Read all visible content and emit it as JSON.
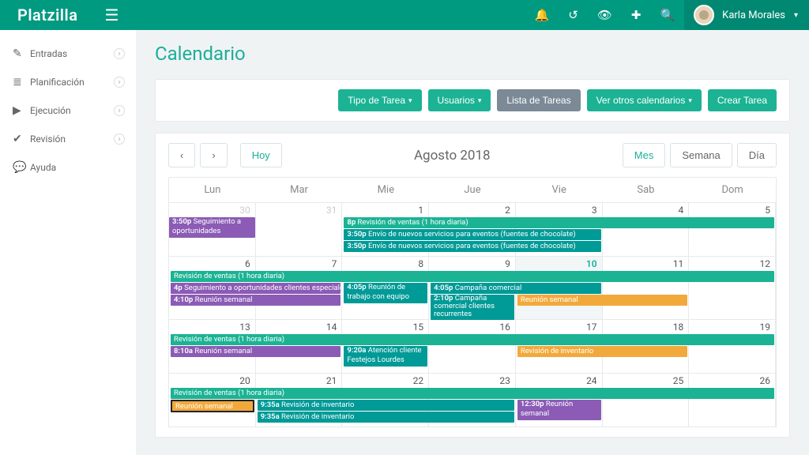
{
  "brand": "Platzilla",
  "user": {
    "name": "Karla Morales"
  },
  "sidebar": {
    "items": [
      {
        "icon": "✎",
        "label": "Entradas",
        "chev": true
      },
      {
        "icon": "≣",
        "label": "Planificación",
        "chev": true
      },
      {
        "icon": "▶",
        "label": "Ejecución",
        "chev": true
      },
      {
        "icon": "✔",
        "label": "Revisión",
        "chev": true
      },
      {
        "icon": "💬",
        "label": "Ayuda",
        "chev": false
      }
    ]
  },
  "page": {
    "title": "Calendario"
  },
  "toolbar": {
    "tipo": "Tipo de Tarea",
    "usuarios": "Usuarios",
    "lista": "Lista de Tareas",
    "otros": "Ver otros calendarios",
    "crear": "Crear Tarea"
  },
  "calnav": {
    "prev": "‹",
    "next": "›",
    "today": "Hoy",
    "title": "Agosto 2018",
    "mes": "Mes",
    "semana": "Semana",
    "dia": "Día"
  },
  "dayheaders": [
    "Lun",
    "Mar",
    "Mie",
    "Jue",
    "Vie",
    "Sab",
    "Dom"
  ],
  "weeks": [
    {
      "nums": [
        {
          "n": "30",
          "other": true
        },
        {
          "n": "31",
          "other": true
        },
        {
          "n": "1"
        },
        {
          "n": "2"
        },
        {
          "n": "3"
        },
        {
          "n": "4"
        },
        {
          "n": "5"
        }
      ]
    },
    {
      "nums": [
        {
          "n": "6"
        },
        {
          "n": "7"
        },
        {
          "n": "8"
        },
        {
          "n": "9"
        },
        {
          "n": "10",
          "today": true
        },
        {
          "n": "11"
        },
        {
          "n": "12"
        }
      ]
    },
    {
      "nums": [
        {
          "n": "13"
        },
        {
          "n": "14"
        },
        {
          "n": "15"
        },
        {
          "n": "16"
        },
        {
          "n": "17"
        },
        {
          "n": "18"
        },
        {
          "n": "19"
        }
      ]
    },
    {
      "nums": [
        {
          "n": "20"
        },
        {
          "n": "21"
        },
        {
          "n": "22"
        },
        {
          "n": "23"
        },
        {
          "n": "24"
        },
        {
          "n": "25"
        },
        {
          "n": "26"
        }
      ]
    }
  ],
  "events": {
    "w0_seg": {
      "time": "3:50p",
      "title": " Seguimiento a oportunidades"
    },
    "w0_rev": {
      "time": "8p",
      "title": " Revisión de ventas (1 hora diaria)"
    },
    "w0_env1": {
      "time": "3:50p",
      "title": " Envío de nuevos servicios para eventos (fuentes de chocolate)"
    },
    "w0_env2": {
      "time": "3:50p",
      "title": " Envío de nuevos servicios para eventos (fuentes de chocolate)"
    },
    "w1_rev": {
      "title": "Revisión de ventas (1 hora diaria)"
    },
    "w1_seg": {
      "time": "4p",
      "title": " Seguimiento a oportunidades clientes especiales"
    },
    "w1_reu": {
      "time": "4:10p",
      "title": " Reunión semanal"
    },
    "w1_tra": {
      "time": "4:05p",
      "title": " Reunión de trabajo con equipo"
    },
    "w1_camp": {
      "time": "4:05p",
      "title": " Campaña comercial"
    },
    "w1_camp2": {
      "time": "2:10p",
      "title": " Campaña comercial clientes recurrentes"
    },
    "w1_reu2": {
      "title": "Reunión semanal"
    },
    "w2_rev": {
      "title": "Revisión de ventas (1 hora diaria)"
    },
    "w2_reu": {
      "time": "8:10a",
      "title": " Reunión semanal"
    },
    "w2_ate": {
      "time": "9:20a",
      "title": " Atención cliente Festejos Lourdes"
    },
    "w2_revinv": {
      "title": "Revisión de inventario"
    },
    "w3_rev": {
      "title": "Revisión de ventas (1 hora diaria)"
    },
    "w3_reu": {
      "title": "Reunión semanal"
    },
    "w3_inv1": {
      "time": "9:35a",
      "title": " Revisión de inventario"
    },
    "w3_inv2": {
      "time": "9:35a",
      "title": " Revisión de inventario"
    },
    "w3_reu2": {
      "time": "12:30p",
      "title": " Reunión semanal"
    }
  }
}
